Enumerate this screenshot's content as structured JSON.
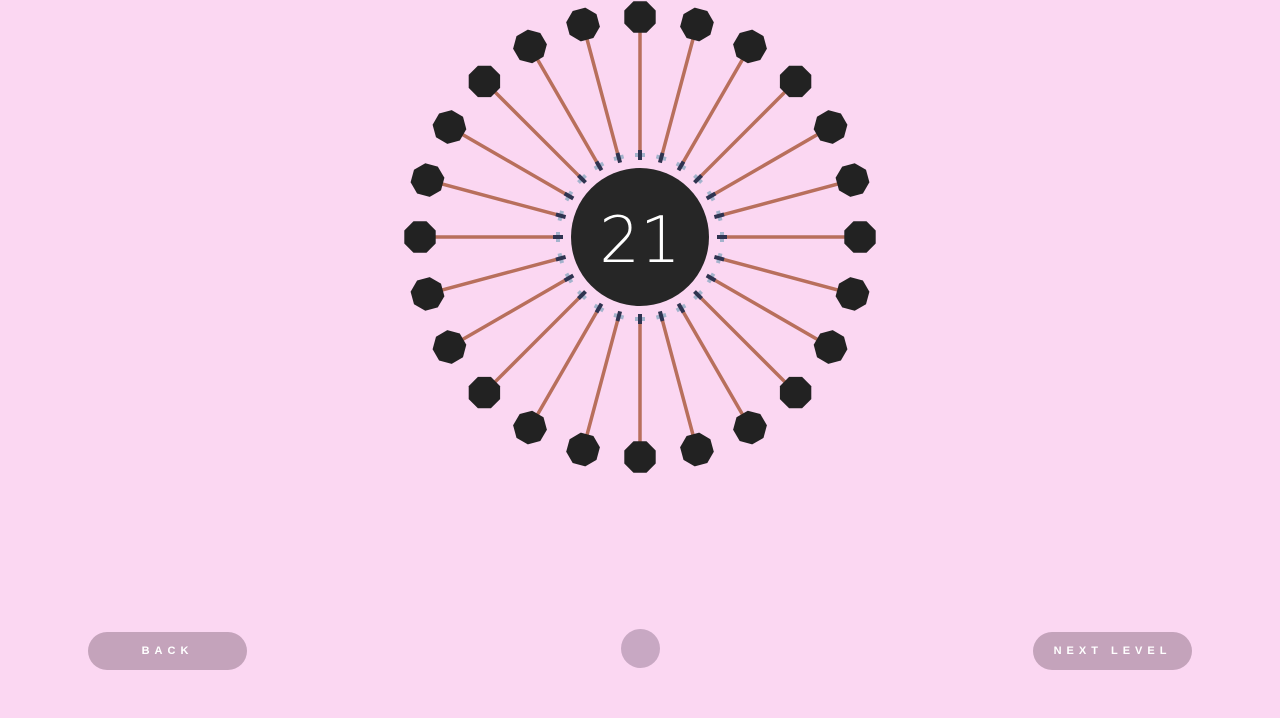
{
  "level": {
    "number": "21",
    "pin_count": 24
  },
  "buttons": {
    "back_label": "BACK",
    "next_level_label": "NEXT LEVEL"
  },
  "colors": {
    "background": "#fbd7f2",
    "core": "#262626",
    "pin_head": "#222222",
    "pin_line": "#b86f5c",
    "pin_tip_light": "#a3b3cc",
    "pin_tip_dark": "#2f3350",
    "button_fill": "#c4a3bb",
    "center_dot": "#c8a8c3"
  },
  "icons": {
    "center_control": "circle-icon"
  }
}
